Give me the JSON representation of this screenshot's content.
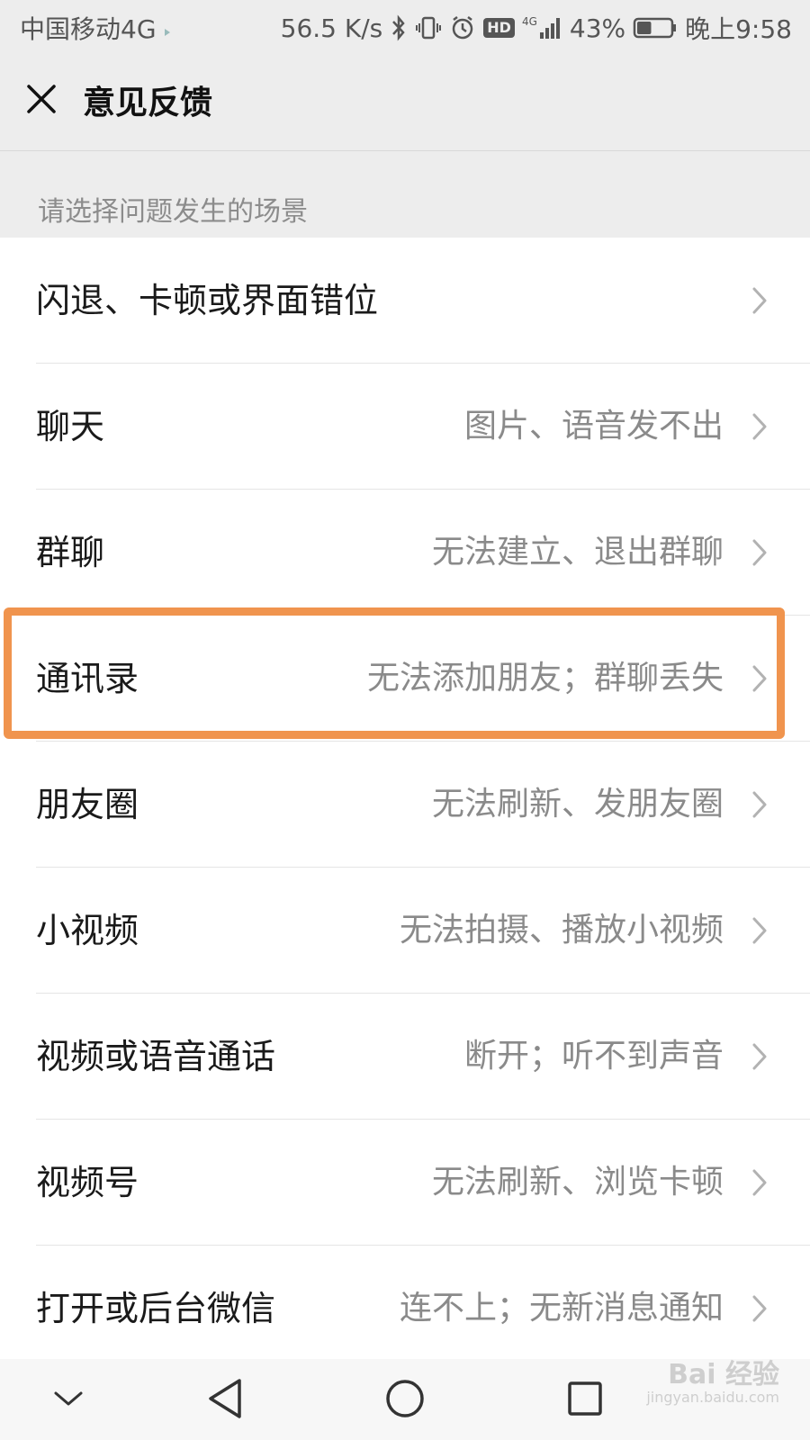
{
  "status_bar": {
    "carrier": "中国移动4G",
    "net_speed": "56.5 K/s",
    "network_type": "4G",
    "hd_label": "HD",
    "battery_percent": "43%",
    "battery_level": 0.43,
    "time": "晚上9:58"
  },
  "header": {
    "title": "意见反馈"
  },
  "section": {
    "label": "请选择问题发生的场景"
  },
  "scenarios": [
    {
      "title": "闪退、卡顿或界面错位",
      "desc": ""
    },
    {
      "title": "聊天",
      "desc": "图片、语音发不出"
    },
    {
      "title": "群聊",
      "desc": "无法建立、退出群聊"
    },
    {
      "title": "通讯录",
      "desc": "无法添加朋友；群聊丢失"
    },
    {
      "title": "朋友圈",
      "desc": "无法刷新、发朋友圈"
    },
    {
      "title": "小视频",
      "desc": "无法拍摄、播放小视频"
    },
    {
      "title": "视频或语音通话",
      "desc": "断开；听不到声音"
    },
    {
      "title": "视频号",
      "desc": "无法刷新、浏览卡顿"
    },
    {
      "title": "打开或后台微信",
      "desc": "连不上；无新消息通知"
    }
  ],
  "watermark": {
    "brand": "Bai 经验",
    "url": "jingyan.baidu.com"
  },
  "colors": {
    "highlight": "#f0944e",
    "background": "#ededed",
    "list_bg": "#ffffff",
    "secondary_text": "#8a8a8a"
  }
}
